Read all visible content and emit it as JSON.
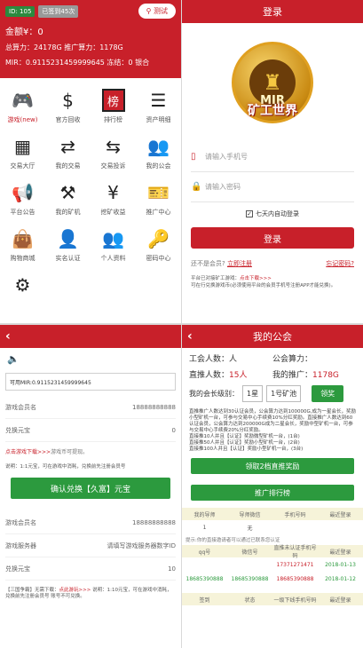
{
  "panel1": {
    "id_badge": "ID: 105",
    "sign_badge": "已签到45次",
    "test_button": "测试",
    "line1": "金额¥：0",
    "line2": "总算力：24178G 推广算力：1178G",
    "line3": "MIR：0.9115231459999645 冻结：0 银合",
    "grid": [
      {
        "label": "游戏(new)",
        "icon": "gamepad-icon",
        "glyph": "🎮"
      },
      {
        "label": "官方回收",
        "icon": "money-recycle-icon",
        "glyph": "$"
      },
      {
        "label": "排行榜",
        "icon": "ranking-icon",
        "glyph": "榜"
      },
      {
        "label": "资产明细",
        "icon": "list-icon",
        "glyph": "☰"
      },
      {
        "label": "交易大厅",
        "icon": "buildings-icon",
        "glyph": "▦"
      },
      {
        "label": "我的交易",
        "icon": "exchange-icon",
        "glyph": "⇄"
      },
      {
        "label": "交易投诉",
        "icon": "complaint-icon",
        "glyph": "⇆"
      },
      {
        "label": "我的公会",
        "icon": "group-icon",
        "glyph": "👥"
      },
      {
        "label": "平台公告",
        "icon": "megaphone-icon",
        "glyph": "📢"
      },
      {
        "label": "我的矿机",
        "icon": "pickaxe-icon",
        "glyph": "⚒"
      },
      {
        "label": "挖矿收益",
        "icon": "yen-cycle-icon",
        "glyph": "¥"
      },
      {
        "label": "推广中心",
        "icon": "ticket-icon",
        "glyph": "🎫"
      },
      {
        "label": "购物商城",
        "icon": "shopping-bag-icon",
        "glyph": "👜"
      },
      {
        "label": "实名认证",
        "icon": "user-verify-icon",
        "glyph": "👤"
      },
      {
        "label": "个人资料",
        "icon": "profile-icon",
        "glyph": "👥"
      },
      {
        "label": "密码中心",
        "icon": "key-icon",
        "glyph": "🔑"
      },
      {
        "label": "",
        "icon": "settings-icon",
        "glyph": "⚙"
      }
    ]
  },
  "panel2": {
    "title": "登录",
    "logo_text": "MIR",
    "logo_slogan": "矿工世界",
    "phone_placeholder": "请输入手机号",
    "password_placeholder": "请输入密码",
    "remember": "七天内自动登录",
    "login_button": "登录",
    "no_account": "还不是会员?",
    "register_link": "立即注册",
    "forgot_link": "忘记密码?",
    "note1_prefix": "平台已对接矿工游戏：",
    "note1_link": "点击下载>>>",
    "note2": "可在行兑换游戏币(必须使用平台的会员手机号注册APP才能兑换)。"
  },
  "panel3": {
    "mir_label": "可用MIR:0.9115231459999645",
    "rows_top": [
      {
        "label": "游戏会员名",
        "value": "18888888888"
      },
      {
        "label": "兑换元宝",
        "value": "0"
      }
    ],
    "download_link": "点击游戏下载>>>",
    "download_text": "游戏币可提现。",
    "desc": "说明：1:1元宝，可在游戏中消耗，兑换前先注册会员号",
    "exchange_button": "确认兑换【久富】元宝",
    "rows_bottom": [
      {
        "label": "游戏会员名",
        "value": "18888888888"
      },
      {
        "label": "游戏服务器",
        "value": "请填写游戏服务器数字ID"
      },
      {
        "label": "兑换元宝",
        "value": "10"
      }
    ],
    "foot_prefix": "【三国争霸】无需下载：",
    "foot_link": "点此游玩>>>",
    "foot_text": "说明：1:10元宝，可在游戏中消耗，兑换前先注册会员号 账号不可兑换。"
  },
  "panel4": {
    "title": "我的公会",
    "guild_count_label": "工会人数：",
    "guild_count_value": "人",
    "guild_power_label": "公会算力：",
    "guild_power_value": "",
    "direct_label": "直推人数：",
    "direct_value": "15人",
    "promo_label": "我的推广：",
    "promo_value": "1178G",
    "level_label": "我的会长级别：",
    "level_num": "1星",
    "level_select": "1号矿池",
    "change_button": "领奖",
    "rules": [
      "直推推广人数达到30认证会员，公会算力达到100000G,成为一星会长，奖励小型矿机一台，可参与交易中心手续费10%分红奖励。直接推广人数达到60认证会员，公会算力达到200000G成为二星会长，奖励中型矿机一台，可参与交易中心手续费20%分红奖励。",
      "直接推10人并且【认证】奖励微型矿机一台，(1台)",
      "直接推50人并且【认证】奖励小型矿机一台，(2台)",
      "直接推100人并且【认证】奖励小型矿机一台，(3台)"
    ],
    "button1": "领取2档直推奖励",
    "button2": "推广排行榜",
    "table1_head": [
      "我的导师",
      "导师微信",
      "手机号码",
      "最近登录"
    ],
    "table1_row": [
      "1",
      "无",
      "",
      ""
    ],
    "table_note": "提示:你的直接邀请者可以通过已联系您认证",
    "table2_head": [
      "qq号",
      "微信号",
      "直推未认证手机号码",
      "最近登录"
    ],
    "table2_rows": [
      [
        "",
        "",
        "17371271471",
        "2018-01-13"
      ],
      [
        "18685390888",
        "18685390888",
        "18685390888",
        "2018-01-12"
      ]
    ],
    "table3_head": [
      "签到",
      "状态",
      "一级下线手机号码",
      "最近登录"
    ]
  },
  "colors": {
    "brand_red": "#c8202a",
    "green": "#2c9a3e"
  }
}
